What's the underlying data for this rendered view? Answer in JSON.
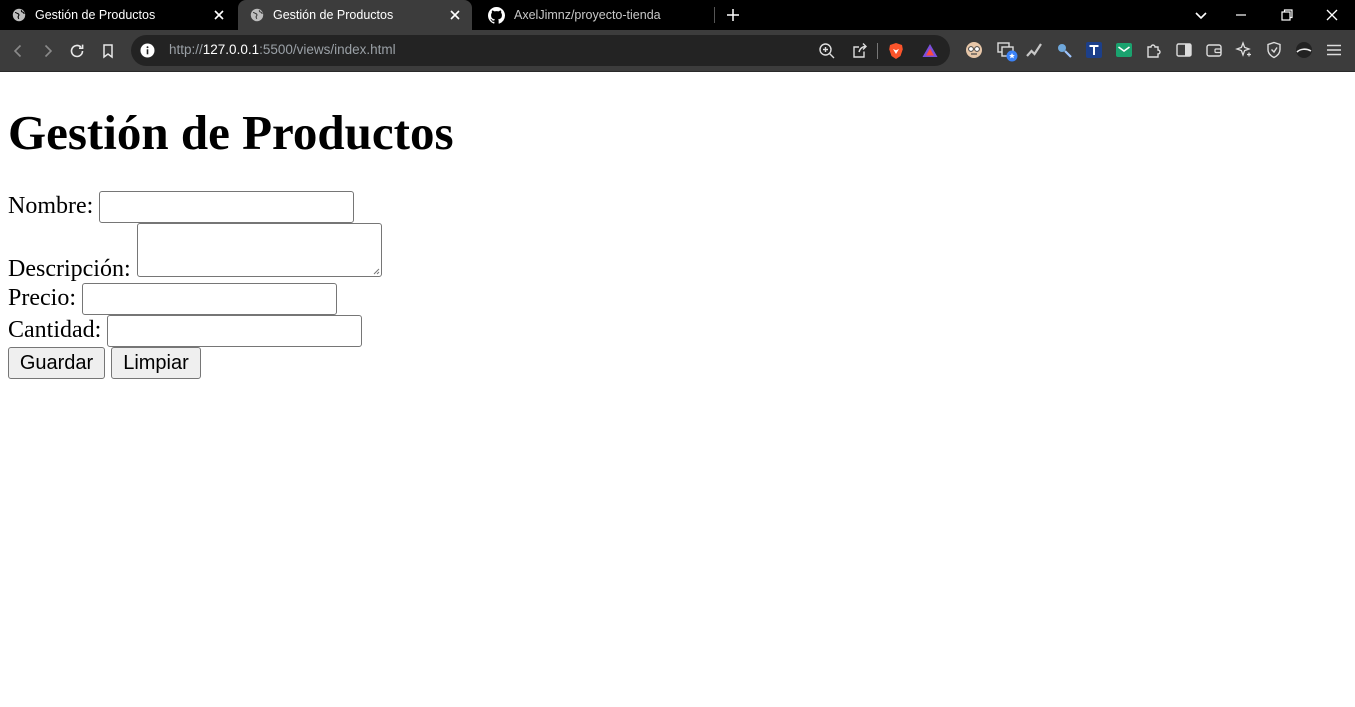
{
  "tabs": [
    {
      "title": "Gestión de Productos",
      "icon": "globe-icon",
      "active": false
    },
    {
      "title": "Gestión de Productos",
      "icon": "globe-icon",
      "active": true
    },
    {
      "title": "AxelJimnz/proyecto-tienda",
      "icon": "github-icon",
      "active": false
    }
  ],
  "toolbar": {
    "url_scheme": "http://",
    "url_host": "127.0.0.1",
    "url_rest": ":5500/views/index.html"
  },
  "page": {
    "heading": "Gestión de Productos",
    "labels": {
      "nombre": "Nombre:",
      "descripcion": "Descripción:",
      "precio": "Precio:",
      "cantidad": "Cantidad:"
    },
    "values": {
      "nombre": "",
      "descripcion": "",
      "precio": "",
      "cantidad": ""
    },
    "buttons": {
      "guardar": "Guardar",
      "limpiar": "Limpiar"
    }
  }
}
